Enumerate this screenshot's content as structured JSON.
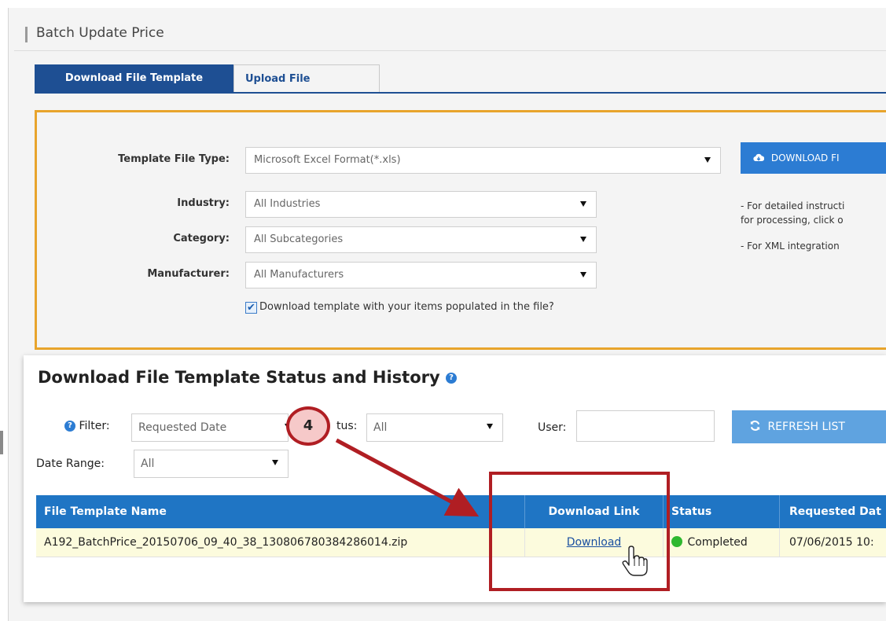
{
  "page": {
    "title": "Batch Update Price"
  },
  "tabs": [
    {
      "label": "Download File Template",
      "active": true
    },
    {
      "label": "Upload File",
      "active": false
    }
  ],
  "form": {
    "template_file_type": {
      "label": "Template File Type:",
      "value": "Microsoft Excel Format(*.xls)"
    },
    "industry": {
      "label": "Industry:",
      "value": "All Industries"
    },
    "category": {
      "label": "Category:",
      "value": "All Subcategories"
    },
    "manufacturer": {
      "label": "Manufacturer:",
      "value": "All Manufacturers"
    },
    "populate_checkbox": {
      "label": "Download template with your items populated in the file?",
      "checked": true
    },
    "download_button": {
      "label": "DOWNLOAD FI"
    },
    "notes": [
      "- For detailed instructi",
      "for processing, click o",
      "- For XML integration"
    ]
  },
  "status_section": {
    "title": "Download File Template Status and History",
    "filter": {
      "label": "Filter:",
      "value": "Requested Date"
    },
    "status": {
      "label": "tus:",
      "value": "All"
    },
    "user": {
      "label": "User:",
      "value": ""
    },
    "refresh_button": {
      "label": "REFRESH LIST"
    },
    "date_range": {
      "label": "Date Range:",
      "value": "All"
    }
  },
  "table": {
    "columns": [
      "File Template Name",
      "Download Link",
      "Status",
      "Requested Dat"
    ],
    "rows": [
      {
        "file_name": "A192_BatchPrice_20150706_09_40_38_130806780384286014.zip",
        "download_link": "Download",
        "status": "Completed",
        "requested_date": "07/06/2015 10:"
      }
    ]
  },
  "annotation": {
    "step_number": "4"
  },
  "colors": {
    "primary": "#1e4f93",
    "accent_orange": "#e8a42c",
    "table_header": "#1f75c4",
    "highlight_red": "#b01e23",
    "status_green": "#2fb82f",
    "row_highlight": "#fcfbdd"
  },
  "icons": {
    "cloud_download": "cloud-download-icon",
    "refresh": "refresh-icon",
    "help": "question-circle-icon",
    "cursor": "hand-pointer-icon"
  }
}
